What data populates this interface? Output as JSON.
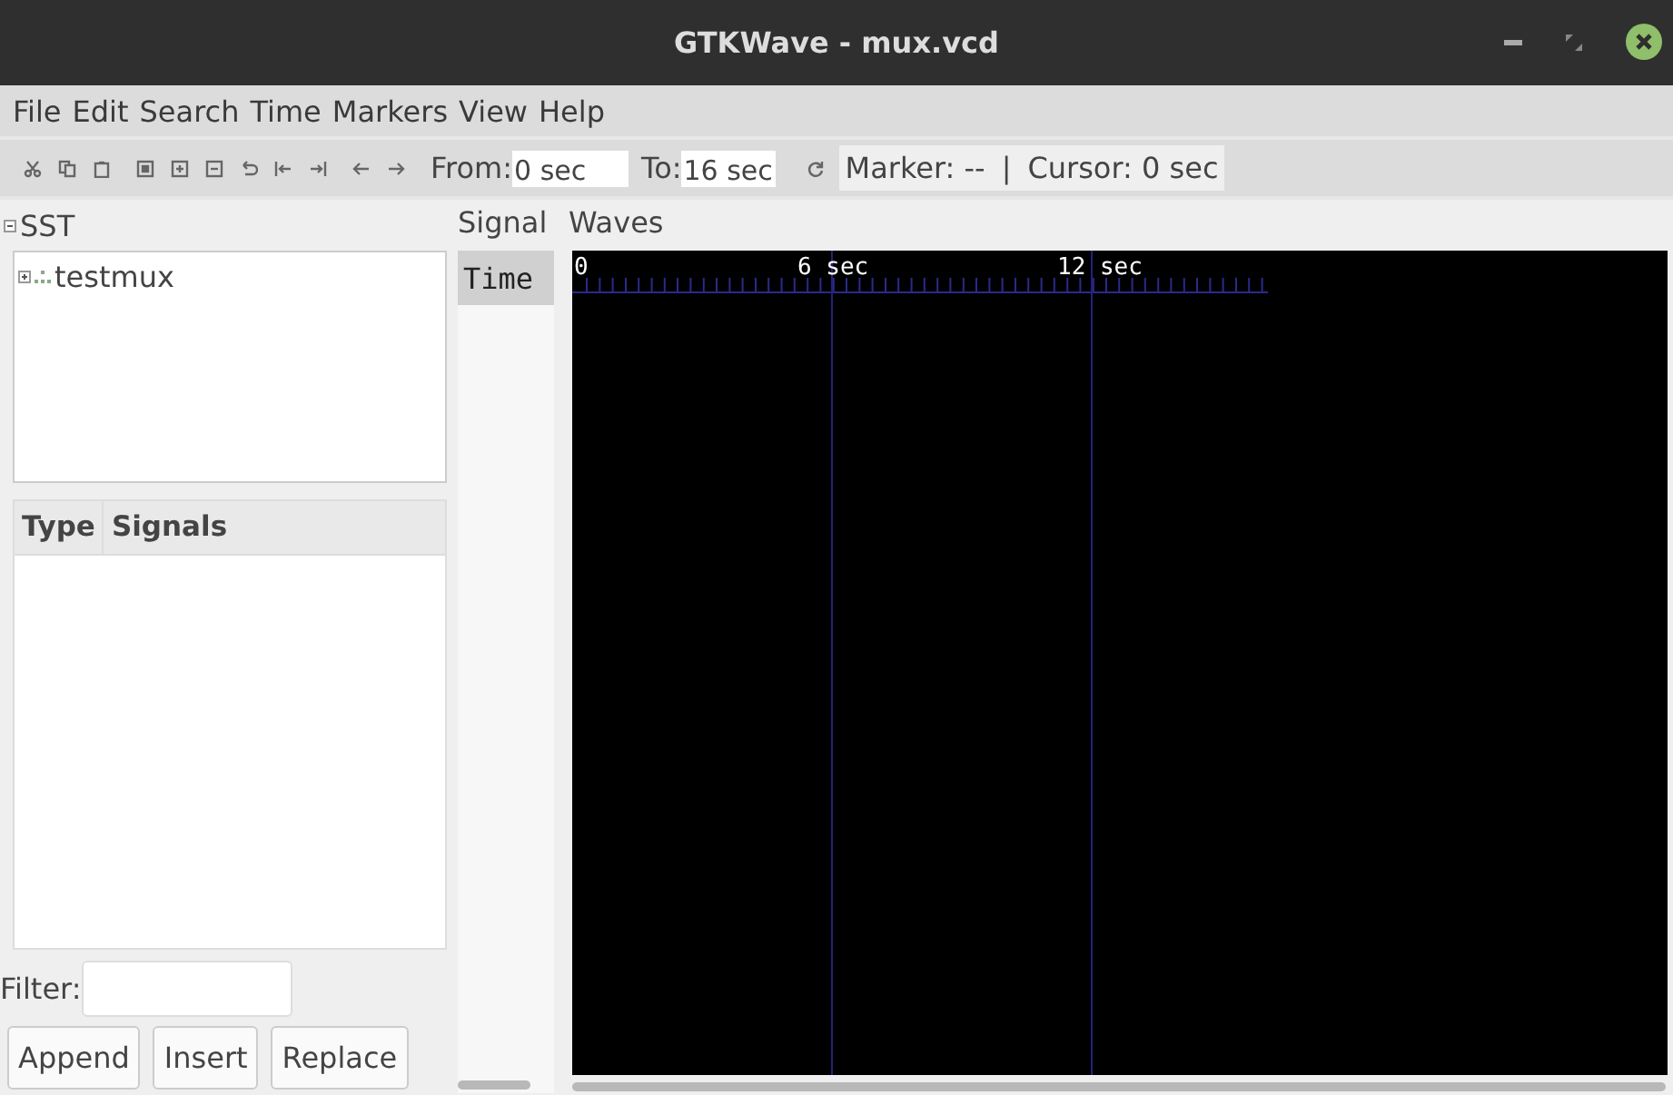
{
  "window": {
    "title": "GTKWave - mux.vcd"
  },
  "menu": [
    "File",
    "Edit",
    "Search",
    "Time",
    "Markers",
    "View",
    "Help"
  ],
  "toolbar": {
    "from_label": "From:",
    "from_value": "0 sec",
    "to_label": "To:",
    "to_value": "16 sec",
    "marker": "Marker: --",
    "separator": "|",
    "cursor": "Cursor: 0 sec"
  },
  "sst": {
    "title": "SST",
    "expanded": true,
    "tree": [
      {
        "label": "testmux",
        "expanded": false
      }
    ]
  },
  "signals_table": {
    "columns": [
      "Type",
      "Signals"
    ]
  },
  "filter": {
    "label": "Filter:"
  },
  "buttons": [
    "Append",
    "Insert",
    "Replace"
  ],
  "signal_pane": {
    "title": "Signal",
    "rows": [
      {
        "label": "Time",
        "selected": true
      }
    ]
  },
  "waves": {
    "title": "Waves",
    "time_labels": [
      "0",
      "6 sec",
      "12 sec"
    ]
  }
}
